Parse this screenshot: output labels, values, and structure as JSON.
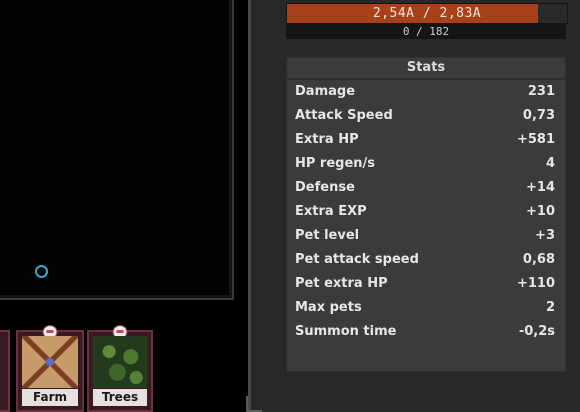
{
  "hp": {
    "text": "2,54A / 2,83A",
    "fill_fraction": 0.897
  },
  "xp": {
    "text": "0 / 182"
  },
  "stats": {
    "title": "Stats",
    "rows": [
      {
        "label": "Damage",
        "value": "231"
      },
      {
        "label": "Attack Speed",
        "value": "0,73"
      },
      {
        "label": "Extra HP",
        "value": "+581"
      },
      {
        "label": "HP regen/s",
        "value": "4"
      },
      {
        "label": "Defense",
        "value": "+14"
      },
      {
        "label": "Extra EXP",
        "value": "+10"
      },
      {
        "label": "Pet level",
        "value": "+3"
      },
      {
        "label": "Pet attack speed",
        "value": "0,68"
      },
      {
        "label": "Pet extra HP",
        "value": "+110"
      },
      {
        "label": "Max pets",
        "value": "2"
      },
      {
        "label": "Summon time",
        "value": "-0,2s"
      }
    ]
  },
  "cards": [
    {
      "label": "Farm"
    },
    {
      "label": "Trees"
    }
  ],
  "colors": {
    "hp_fill": "#a8401a",
    "card_border": "#6e2f3e",
    "ring": "#3aa7cf"
  }
}
